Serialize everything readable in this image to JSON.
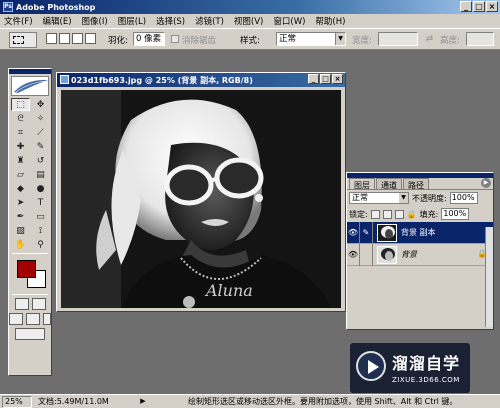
{
  "app": {
    "title": "Adobe Photoshop"
  },
  "menu": [
    "文件(F)",
    "编辑(E)",
    "图像(I)",
    "图层(L)",
    "选择(S)",
    "滤镜(T)",
    "视图(V)",
    "窗口(W)",
    "帮助(H)"
  ],
  "options": {
    "feather_label": "羽化:",
    "feather_value": "0 像素",
    "antialias_label": "消除锯齿",
    "style_label": "样式:",
    "style_value": "正常",
    "width_label": "宽度:",
    "height_label": "高度:"
  },
  "document": {
    "title": "023d1fb693.jpg @ 25% (背景 副本, RGB/8)",
    "shirt_text": "Aluna"
  },
  "layers_panel": {
    "tabs": [
      "图层",
      "通道",
      "路径"
    ],
    "blend_mode": "正常",
    "opacity_label": "不透明度:",
    "opacity_value": "100%",
    "lock_label": "锁定:",
    "fill_label": "填充:",
    "fill_value": "100%",
    "layers": [
      {
        "name": "背景 副本",
        "selected": true
      },
      {
        "name": "背景",
        "selected": false
      }
    ]
  },
  "colors": {
    "foreground": "#a00000",
    "background": "#ffffff"
  },
  "status": {
    "zoom": "25%",
    "doc_size": "文档:5.49M/11.0M",
    "hint": "绘制矩形选区或移动选区外框。要用附加选项，使用 Shift、Alt 和 Ctrl 键。"
  },
  "watermark": {
    "title": "溜溜自学",
    "url": "ZIXUE.3D66.COM"
  }
}
